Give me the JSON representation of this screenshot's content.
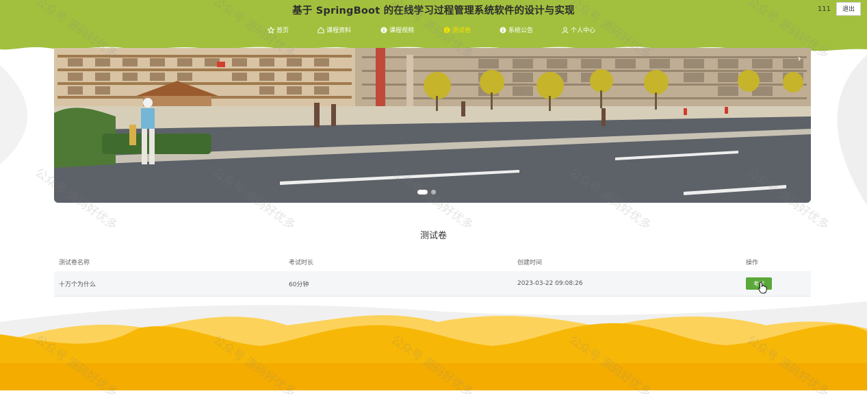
{
  "site": {
    "title": "基于 SpringBoot 的在线学习过程管理系统软件的设计与实现"
  },
  "user": {
    "name": "111",
    "logout_label": "退出"
  },
  "nav": {
    "items": [
      {
        "label": "首页",
        "icon": "star-icon"
      },
      {
        "label": "课程资料",
        "icon": "home-icon"
      },
      {
        "label": "课程视频",
        "icon": "info-circle-icon"
      },
      {
        "label": "测试卷",
        "icon": "info-circle-icon",
        "active": true
      },
      {
        "label": "系统公告",
        "icon": "info-circle-icon"
      },
      {
        "label": "个人中心",
        "icon": "user-icon"
      }
    ]
  },
  "carousel": {
    "next_icon": "›",
    "slide_count": 2,
    "active_index": 0
  },
  "section": {
    "title": "测试卷"
  },
  "table": {
    "headers": [
      "测试卷名称",
      "考试时长",
      "创建时间",
      "操作"
    ],
    "rows": [
      {
        "name": "十万个为什么",
        "duration": "60分钟",
        "created": "2023-03-22 09:08:26",
        "action": "考试"
      }
    ]
  },
  "watermark": {
    "text": "公众号 源码好优多"
  },
  "colors": {
    "header_green": "#a2c03e",
    "footer_yellow": "#f7b707",
    "active_nav": "#f3e000",
    "button_green": "#5aa83a"
  }
}
